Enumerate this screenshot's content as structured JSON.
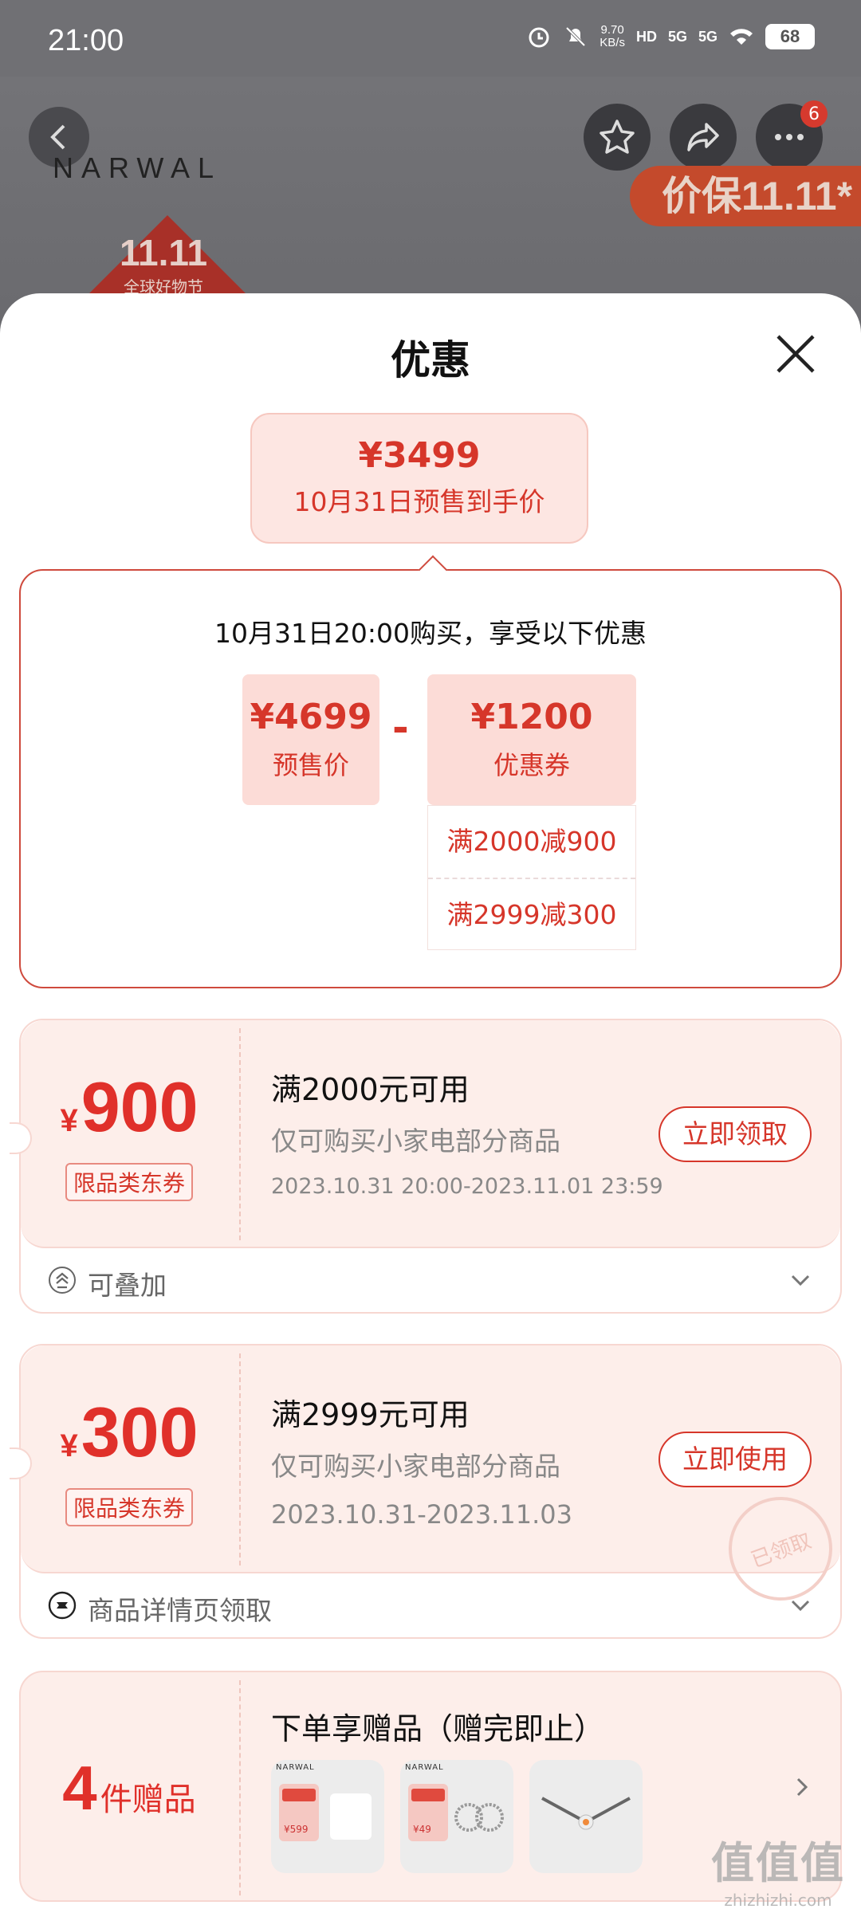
{
  "status": {
    "time": "21:00",
    "net_speed_top": "9.70",
    "net_speed_bottom": "KB/s",
    "hd": "HD",
    "sig1": "5G",
    "sig2": "5G",
    "battery": "68"
  },
  "background_page": {
    "brand": "NARWAL",
    "more_badge": "6",
    "promo_banner": "价保11.11*",
    "event_title": "11.11",
    "event_sub": "全球好物节"
  },
  "sheet": {
    "title": "优惠",
    "final": {
      "price": "¥3499",
      "label": "10月31日预售到手价"
    },
    "detail": {
      "headline": "10月31日20:00购买，享受以下优惠",
      "presale_price": "¥4699",
      "presale_label": "预售价",
      "minus": "-",
      "coupon_total": "¥1200",
      "coupon_label": "优惠券",
      "conditions": [
        "满2000减900",
        "满2999减300"
      ]
    },
    "coupons": [
      {
        "currency": "¥",
        "amount": "900",
        "tag": "限品类东券",
        "title": "满2000元可用",
        "desc": "仅可购买小家电部分商品",
        "date": "2023.10.31 20:00-2023.11.01 23:59",
        "button": "立即领取",
        "footer": "可叠加"
      },
      {
        "currency": "¥",
        "amount": "300",
        "tag": "限品类东券",
        "title": "满2999元可用",
        "desc": "仅可购买小家电部分商品",
        "date": "2023.10.31-2023.11.03",
        "button": "立即使用",
        "stamp": "已领取",
        "footer": "商品详情页领取"
      }
    ],
    "gift": {
      "count": "4",
      "unit": "件赠品",
      "title": "下单享赠品（赠完即止）",
      "thumbs": [
        {
          "brand": "NARWAL",
          "price": "¥599"
        },
        {
          "brand": "NARWAL",
          "price": "¥49"
        },
        {
          "brand": "",
          "price": ""
        }
      ]
    }
  },
  "watermark": {
    "main": "值值值",
    "sub": "zhizhizhi.com"
  },
  "colors": {
    "accent": "#d6362a",
    "card_bg": "#fdeeea",
    "final_bg": "#fde6e2"
  }
}
